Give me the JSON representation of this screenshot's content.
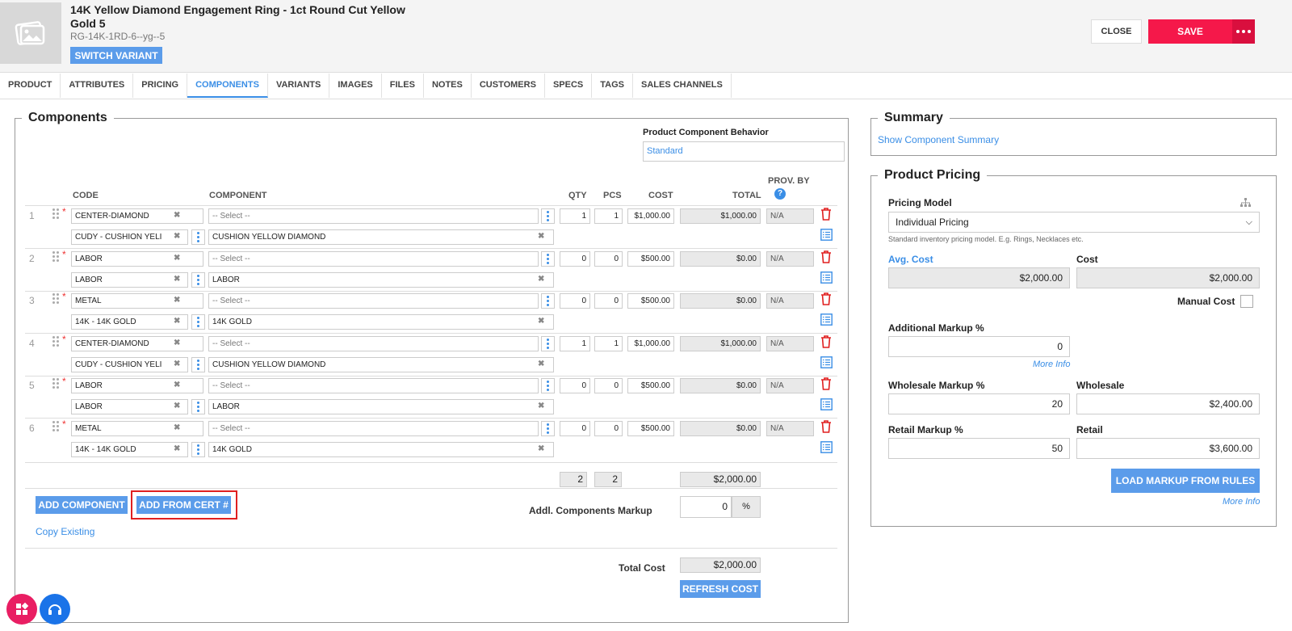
{
  "product": {
    "title": "14K Yellow Diamond Engagement Ring - 1ct Round Cut Yellow Gold 5",
    "sku": "RG-14K-1RD-6--yg--5",
    "switch_variant": "SWITCH VARIANT"
  },
  "actions": {
    "close": "CLOSE",
    "save": "SAVE"
  },
  "tabs": [
    "PRODUCT",
    "ATTRIBUTES",
    "PRICING",
    "COMPONENTS",
    "VARIANTS",
    "IMAGES",
    "FILES",
    "NOTES",
    "CUSTOMERS",
    "SPECS",
    "TAGS",
    "SALES CHANNELS"
  ],
  "active_tab": "COMPONENTS",
  "components": {
    "legend": "Components",
    "behavior_label": "Product Component Behavior",
    "behavior_value": "Standard",
    "headers": {
      "code": "CODE",
      "component": "COMPONENT",
      "qty": "QTY",
      "pcs": "PCS",
      "cost": "COST",
      "total": "TOTAL",
      "prov_by": "PROV. BY"
    },
    "rows": [
      {
        "n": "1",
        "code": "CENTER-DIAMOND",
        "component": "-- Select --",
        "qty": "1",
        "pcs": "1",
        "cost": "$1,000.00",
        "total": "$1,000.00",
        "prov": "N/A",
        "sub_code": "CUDY - CUSHION YELI",
        "sub_component": "CUSHION YELLOW DIAMOND"
      },
      {
        "n": "2",
        "code": "LABOR",
        "component": "-- Select --",
        "qty": "0",
        "pcs": "0",
        "cost": "$500.00",
        "total": "$0.00",
        "prov": "N/A",
        "sub_code": "LABOR",
        "sub_component": "LABOR"
      },
      {
        "n": "3",
        "code": "METAL",
        "component": "-- Select --",
        "qty": "0",
        "pcs": "0",
        "cost": "$500.00",
        "total": "$0.00",
        "prov": "N/A",
        "sub_code": "14K - 14K GOLD",
        "sub_component": "14K GOLD"
      },
      {
        "n": "4",
        "code": "CENTER-DIAMOND",
        "component": "-- Select --",
        "qty": "1",
        "pcs": "1",
        "cost": "$1,000.00",
        "total": "$1,000.00",
        "prov": "N/A",
        "sub_code": "CUDY - CUSHION YELI",
        "sub_component": "CUSHION YELLOW DIAMOND"
      },
      {
        "n": "5",
        "code": "LABOR",
        "component": "-- Select --",
        "qty": "0",
        "pcs": "0",
        "cost": "$500.00",
        "total": "$0.00",
        "prov": "N/A",
        "sub_code": "LABOR",
        "sub_component": "LABOR"
      },
      {
        "n": "6",
        "code": "METAL",
        "component": "-- Select --",
        "qty": "0",
        "pcs": "0",
        "cost": "$500.00",
        "total": "$0.00",
        "prov": "N/A",
        "sub_code": "14K - 14K GOLD",
        "sub_component": "14K GOLD"
      }
    ],
    "totals": {
      "qty": "2",
      "pcs": "2",
      "total": "$2,000.00"
    },
    "add_component": "ADD COMPONENT",
    "add_from_cert": "ADD FROM CERT #",
    "copy_existing": "Copy Existing",
    "markup_label": "Addl. Components Markup",
    "markup_value": "0",
    "markup_unit": "%",
    "total_cost_label": "Total Cost",
    "total_cost_value": "$2,000.00",
    "refresh_cost": "REFRESH COST"
  },
  "summary": {
    "legend": "Summary",
    "link": "Show Component Summary"
  },
  "pricing": {
    "legend": "Product Pricing",
    "model_label": "Pricing Model",
    "model_value": "Individual Pricing",
    "model_hint": "Standard inventory pricing model. E.g. Rings, Necklaces etc.",
    "avg_cost_label": "Avg. Cost",
    "avg_cost_value": "$2,000.00",
    "cost_label": "Cost",
    "cost_value": "$2,000.00",
    "manual_cost_label": "Manual Cost",
    "add_markup_label": "Additional Markup %",
    "add_markup_value": "0",
    "more_info": "More Info",
    "wholesale_markup_label": "Wholesale Markup %",
    "wholesale_markup_value": "20",
    "wholesale_label": "Wholesale",
    "wholesale_value": "$2,400.00",
    "retail_markup_label": "Retail Markup %",
    "retail_markup_value": "50",
    "retail_label": "Retail",
    "retail_value": "$3,600.00",
    "load_markup": "LOAD MARKUP FROM RULES"
  },
  "colors": {
    "accent": "#3a8ee6",
    "save": "#f5184a",
    "button_blue": "#5b9cea",
    "highlight": "#e02020"
  }
}
